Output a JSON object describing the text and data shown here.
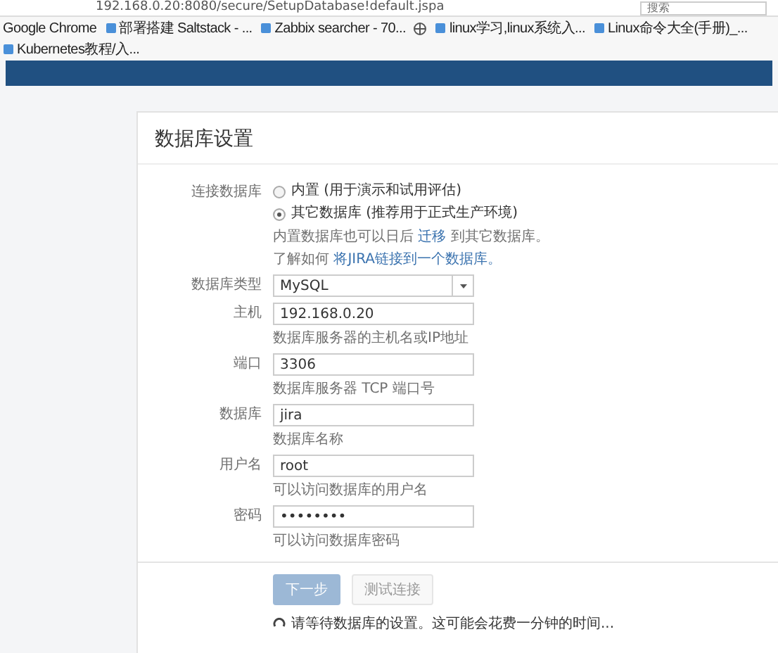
{
  "browser": {
    "url": "192.168.0.20:8080/secure/SetupDatabase!default.jspa",
    "search_placeholder": "搜索",
    "bookmarks": [
      {
        "label": "Google Chrome"
      },
      {
        "label": "部署搭建 Saltstack - ..."
      },
      {
        "label": "Zabbix searcher - 70..."
      },
      {
        "kind": "icon"
      },
      {
        "label": "linux学习,linux系统入..."
      },
      {
        "label": "Linux命令大全(手册)_..."
      },
      {
        "label": "Kubernetes教程/入..."
      }
    ]
  },
  "page": {
    "title": "数据库设置",
    "connection": {
      "label": "连接数据库",
      "options": [
        {
          "label": "内置 (用于演示和试用评估)",
          "selected": false
        },
        {
          "label": "其它数据库 (推荐用于正式生产环境)",
          "selected": true
        }
      ],
      "note_1_prefix": "内置数据库也可以日后",
      "note_1_link": "迁移",
      "note_1_suffix": "到其它数据库。",
      "note_2_prefix": "了解如何",
      "note_2_link": "将JIRA链接到一个数据库。"
    },
    "fields": [
      {
        "kind": "select",
        "label": "数据库类型",
        "value": "MySQL"
      },
      {
        "kind": "text",
        "label": "主机",
        "value": "192.168.0.20",
        "help": "数据库服务器的主机名或IP地址"
      },
      {
        "kind": "text",
        "label": "端口",
        "value": "3306",
        "help": "数据库服务器 TCP 端口号"
      },
      {
        "kind": "text",
        "label": "数据库",
        "value": "jira",
        "help": "数据库名称"
      },
      {
        "kind": "text",
        "label": "用户名",
        "value": "root",
        "help": "可以访问数据库的用户名"
      },
      {
        "kind": "password",
        "label": "密码",
        "value": "••••••••",
        "help": "可以访问数据库密码"
      }
    ],
    "buttons": [
      {
        "label": "下一步",
        "kind": "primary",
        "disabled": true
      },
      {
        "label": "测试连接",
        "kind": "secondary",
        "disabled": true
      }
    ],
    "status": "请等待数据库的设置。这可能会花费一分钟的时间..."
  }
}
